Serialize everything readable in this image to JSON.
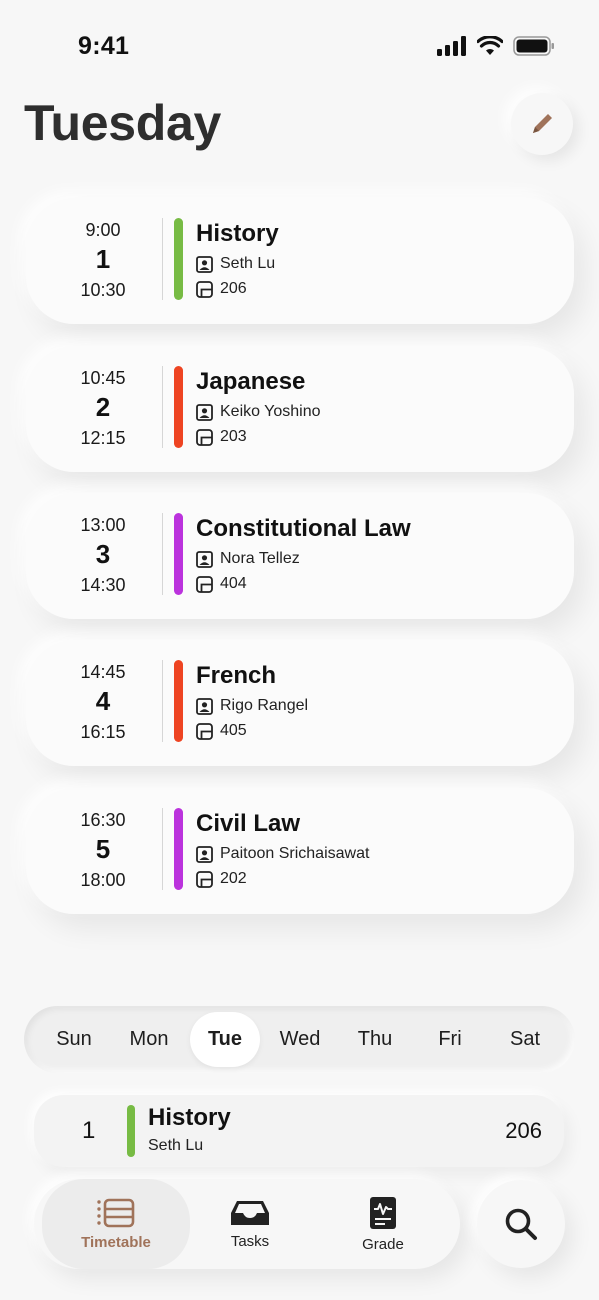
{
  "status_bar": {
    "time": "9:41"
  },
  "header": {
    "title": "Tuesday"
  },
  "colors": {
    "green": "#77bb44",
    "red": "#ee4422",
    "purple": "#bb33dd",
    "accent": "#a0735a"
  },
  "classes": [
    {
      "start": "9:00",
      "period": "1",
      "end": "10:30",
      "subject": "History",
      "teacher": "Seth Lu",
      "room": "206",
      "color": "#77bb44"
    },
    {
      "start": "10:45",
      "period": "2",
      "end": "12:15",
      "subject": "Japanese",
      "teacher": "Keiko Yoshino",
      "room": "203",
      "color": "#ee4422"
    },
    {
      "start": "13:00",
      "period": "3",
      "end": "14:30",
      "subject": "Constitutional Law",
      "teacher": "Nora Tellez",
      "room": "404",
      "color": "#bb33dd"
    },
    {
      "start": "14:45",
      "period": "4",
      "end": "16:15",
      "subject": "French",
      "teacher": "Rigo Rangel",
      "room": "405",
      "color": "#ee4422"
    },
    {
      "start": "16:30",
      "period": "5",
      "end": "18:00",
      "subject": "Civil Law",
      "teacher": "Paitoon Srichaisawat",
      "room": "202",
      "color": "#bb33dd"
    }
  ],
  "days": [
    "Sun",
    "Mon",
    "Tue",
    "Wed",
    "Thu",
    "Fri",
    "Sat"
  ],
  "selected_day": "Tue",
  "next_class": {
    "period": "1",
    "subject": "History",
    "teacher": "Seth Lu",
    "room": "206",
    "color": "#77bb44"
  },
  "tabs": [
    {
      "label": "Timetable",
      "icon": "timetable-icon",
      "active": true
    },
    {
      "label": "Tasks",
      "icon": "tray-icon",
      "active": false
    },
    {
      "label": "Grade",
      "icon": "report-icon",
      "active": false
    }
  ],
  "search": {
    "icon": "search-icon"
  }
}
